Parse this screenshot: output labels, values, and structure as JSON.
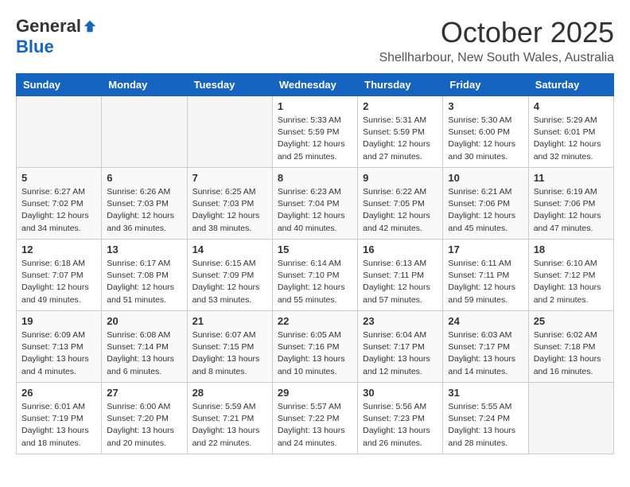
{
  "logo": {
    "general": "General",
    "blue": "Blue"
  },
  "title": "October 2025",
  "location": "Shellharbour, New South Wales, Australia",
  "headers": [
    "Sunday",
    "Monday",
    "Tuesday",
    "Wednesday",
    "Thursday",
    "Friday",
    "Saturday"
  ],
  "weeks": [
    [
      {
        "day": "",
        "info": ""
      },
      {
        "day": "",
        "info": ""
      },
      {
        "day": "",
        "info": ""
      },
      {
        "day": "1",
        "info": "Sunrise: 5:33 AM\nSunset: 5:59 PM\nDaylight: 12 hours\nand 25 minutes."
      },
      {
        "day": "2",
        "info": "Sunrise: 5:31 AM\nSunset: 5:59 PM\nDaylight: 12 hours\nand 27 minutes."
      },
      {
        "day": "3",
        "info": "Sunrise: 5:30 AM\nSunset: 6:00 PM\nDaylight: 12 hours\nand 30 minutes."
      },
      {
        "day": "4",
        "info": "Sunrise: 5:29 AM\nSunset: 6:01 PM\nDaylight: 12 hours\nand 32 minutes."
      }
    ],
    [
      {
        "day": "5",
        "info": "Sunrise: 6:27 AM\nSunset: 7:02 PM\nDaylight: 12 hours\nand 34 minutes."
      },
      {
        "day": "6",
        "info": "Sunrise: 6:26 AM\nSunset: 7:03 PM\nDaylight: 12 hours\nand 36 minutes."
      },
      {
        "day": "7",
        "info": "Sunrise: 6:25 AM\nSunset: 7:03 PM\nDaylight: 12 hours\nand 38 minutes."
      },
      {
        "day": "8",
        "info": "Sunrise: 6:23 AM\nSunset: 7:04 PM\nDaylight: 12 hours\nand 40 minutes."
      },
      {
        "day": "9",
        "info": "Sunrise: 6:22 AM\nSunset: 7:05 PM\nDaylight: 12 hours\nand 42 minutes."
      },
      {
        "day": "10",
        "info": "Sunrise: 6:21 AM\nSunset: 7:06 PM\nDaylight: 12 hours\nand 45 minutes."
      },
      {
        "day": "11",
        "info": "Sunrise: 6:19 AM\nSunset: 7:06 PM\nDaylight: 12 hours\nand 47 minutes."
      }
    ],
    [
      {
        "day": "12",
        "info": "Sunrise: 6:18 AM\nSunset: 7:07 PM\nDaylight: 12 hours\nand 49 minutes."
      },
      {
        "day": "13",
        "info": "Sunrise: 6:17 AM\nSunset: 7:08 PM\nDaylight: 12 hours\nand 51 minutes."
      },
      {
        "day": "14",
        "info": "Sunrise: 6:15 AM\nSunset: 7:09 PM\nDaylight: 12 hours\nand 53 minutes."
      },
      {
        "day": "15",
        "info": "Sunrise: 6:14 AM\nSunset: 7:10 PM\nDaylight: 12 hours\nand 55 minutes."
      },
      {
        "day": "16",
        "info": "Sunrise: 6:13 AM\nSunset: 7:11 PM\nDaylight: 12 hours\nand 57 minutes."
      },
      {
        "day": "17",
        "info": "Sunrise: 6:11 AM\nSunset: 7:11 PM\nDaylight: 12 hours\nand 59 minutes."
      },
      {
        "day": "18",
        "info": "Sunrise: 6:10 AM\nSunset: 7:12 PM\nDaylight: 13 hours\nand 2 minutes."
      }
    ],
    [
      {
        "day": "19",
        "info": "Sunrise: 6:09 AM\nSunset: 7:13 PM\nDaylight: 13 hours\nand 4 minutes."
      },
      {
        "day": "20",
        "info": "Sunrise: 6:08 AM\nSunset: 7:14 PM\nDaylight: 13 hours\nand 6 minutes."
      },
      {
        "day": "21",
        "info": "Sunrise: 6:07 AM\nSunset: 7:15 PM\nDaylight: 13 hours\nand 8 minutes."
      },
      {
        "day": "22",
        "info": "Sunrise: 6:05 AM\nSunset: 7:16 PM\nDaylight: 13 hours\nand 10 minutes."
      },
      {
        "day": "23",
        "info": "Sunrise: 6:04 AM\nSunset: 7:17 PM\nDaylight: 13 hours\nand 12 minutes."
      },
      {
        "day": "24",
        "info": "Sunrise: 6:03 AM\nSunset: 7:17 PM\nDaylight: 13 hours\nand 14 minutes."
      },
      {
        "day": "25",
        "info": "Sunrise: 6:02 AM\nSunset: 7:18 PM\nDaylight: 13 hours\nand 16 minutes."
      }
    ],
    [
      {
        "day": "26",
        "info": "Sunrise: 6:01 AM\nSunset: 7:19 PM\nDaylight: 13 hours\nand 18 minutes."
      },
      {
        "day": "27",
        "info": "Sunrise: 6:00 AM\nSunset: 7:20 PM\nDaylight: 13 hours\nand 20 minutes."
      },
      {
        "day": "28",
        "info": "Sunrise: 5:59 AM\nSunset: 7:21 PM\nDaylight: 13 hours\nand 22 minutes."
      },
      {
        "day": "29",
        "info": "Sunrise: 5:57 AM\nSunset: 7:22 PM\nDaylight: 13 hours\nand 24 minutes."
      },
      {
        "day": "30",
        "info": "Sunrise: 5:56 AM\nSunset: 7:23 PM\nDaylight: 13 hours\nand 26 minutes."
      },
      {
        "day": "31",
        "info": "Sunrise: 5:55 AM\nSunset: 7:24 PM\nDaylight: 13 hours\nand 28 minutes."
      },
      {
        "day": "",
        "info": ""
      }
    ]
  ]
}
